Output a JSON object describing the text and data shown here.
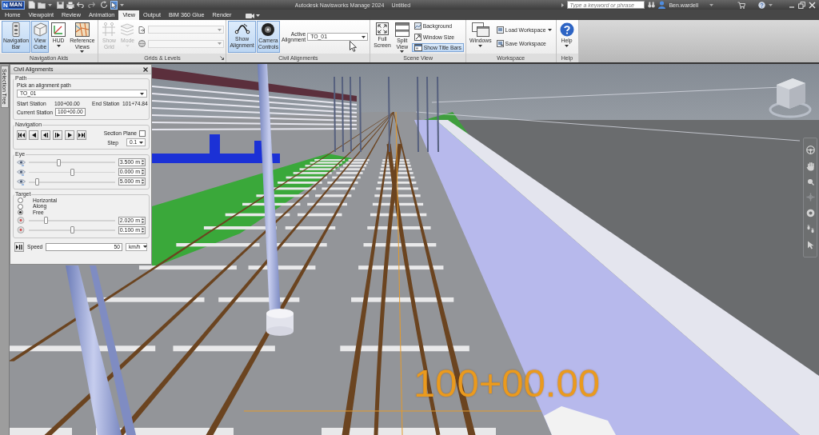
{
  "title_bar": {
    "app_menu": {
      "letter": "N",
      "edition": "MAN"
    },
    "quick_access": {
      "select_tool_on": true
    },
    "title": "Autodesk Navisworks Manage 2024",
    "document": "Untitled",
    "search": {
      "placeholder": "Type a keyword or phrase"
    },
    "user": "Ben.wardell"
  },
  "tabs": [
    {
      "label": "Home",
      "selected": false
    },
    {
      "label": "Viewpoint",
      "selected": false
    },
    {
      "label": "Review",
      "selected": false
    },
    {
      "label": "Animation",
      "selected": false
    },
    {
      "label": "View",
      "selected": true
    },
    {
      "label": "Output",
      "selected": false
    },
    {
      "label": "BIM 360 Glue",
      "selected": false
    },
    {
      "label": "Render",
      "selected": false
    }
  ],
  "ribbon": {
    "panels": [
      {
        "title": "Navigation Aids",
        "launcher": false,
        "items": [
          {
            "kind": "large",
            "label": "Navigation Bar",
            "active": true,
            "disabled": false,
            "dropdown": false
          },
          {
            "kind": "large",
            "label": "View Cube",
            "active": true,
            "disabled": false,
            "dropdown": false
          },
          {
            "kind": "large",
            "label": "HUD",
            "active": false,
            "disabled": false,
            "dropdown": true
          },
          {
            "kind": "large",
            "label": "Reference Views",
            "active": false,
            "disabled": false,
            "dropdown": true
          }
        ]
      },
      {
        "title": "Grids & Levels",
        "launcher": true,
        "items": [
          {
            "kind": "large",
            "label": "Show Grid",
            "active": false,
            "disabled": true,
            "dropdown": false
          },
          {
            "kind": "large",
            "label": "Mode",
            "active": false,
            "disabled": true,
            "dropdown": true
          },
          {
            "kind": "combo",
            "disabled": true
          },
          {
            "kind": "combo",
            "disabled": true
          }
        ]
      },
      {
        "title": "Civil Alignments",
        "launcher": false,
        "items": [
          {
            "kind": "large",
            "label": "Show Alignment",
            "active": true,
            "disabled": false,
            "dropdown": false
          },
          {
            "kind": "large",
            "label": "Camera Controls",
            "active": true,
            "disabled": false,
            "dropdown": false
          },
          {
            "kind": "field",
            "label": "Active Alignment",
            "value": "TO_01"
          }
        ]
      },
      {
        "title": "Scene View",
        "launcher": false,
        "items": [
          {
            "kind": "large",
            "label": "Full Screen",
            "active": false,
            "disabled": false,
            "dropdown": false
          },
          {
            "kind": "large",
            "label": "Split View",
            "active": false,
            "disabled": false,
            "dropdown": true
          },
          {
            "kind": "small",
            "label": "Background",
            "active": false,
            "disabled": false,
            "dropdown": false
          },
          {
            "kind": "small",
            "label": "Window Size",
            "active": false,
            "disabled": false,
            "dropdown": false
          },
          {
            "kind": "small",
            "label": "Show Title Bars",
            "active": true,
            "disabled": false,
            "dropdown": false
          }
        ]
      },
      {
        "title": "Workspace",
        "launcher": false,
        "items": [
          {
            "kind": "large",
            "label": "Windows",
            "active": false,
            "disabled": false,
            "dropdown": true
          },
          {
            "kind": "small",
            "label": "Load Workspace",
            "active": false,
            "disabled": false,
            "dropdown": true
          },
          {
            "kind": "small",
            "label": "Save Workspace",
            "active": false,
            "disabled": false,
            "dropdown": false
          }
        ]
      },
      {
        "title": "Help",
        "launcher": false,
        "items": [
          {
            "kind": "large",
            "label": "Help",
            "active": false,
            "disabled": false,
            "dropdown": true
          }
        ]
      }
    ]
  },
  "side_tab": "Selection Tree",
  "alignments_panel": {
    "title": "Civil Alignments",
    "path": {
      "legend": "Path",
      "prompt": "Pick an alignment path",
      "alignment": "TO_01",
      "start_label": "Start Station",
      "start": "100+00.00",
      "end_label": "End Station",
      "end": "101+74.84",
      "current_label": "Current Station",
      "current": "100+00.00"
    },
    "navigation": {
      "legend": "Navigation",
      "section_plane": {
        "label": "Section Plane",
        "checked": false
      },
      "step": {
        "label": "Step",
        "value": "0.1"
      }
    },
    "eye": {
      "legend": "Eye",
      "rows": [
        {
          "level": 0.35,
          "value": "3.500 m"
        },
        {
          "level": 0.5,
          "value": "0.000 m"
        },
        {
          "level": 0.1,
          "value": "5.000 m"
        }
      ]
    },
    "target": {
      "legend": "Target",
      "modes": [
        {
          "label": "Horizontal",
          "selected": false
        },
        {
          "label": "Along",
          "selected": false
        },
        {
          "label": "Free",
          "selected": true
        }
      ],
      "rows": [
        {
          "level": 0.2,
          "value": "2.020 m"
        },
        {
          "level": 0.5,
          "value": "0.100 m"
        }
      ]
    },
    "speed": {
      "label": "Speed",
      "value": "50",
      "unit": "km/h"
    }
  },
  "viewport": {
    "station_label": "100+00.00"
  }
}
